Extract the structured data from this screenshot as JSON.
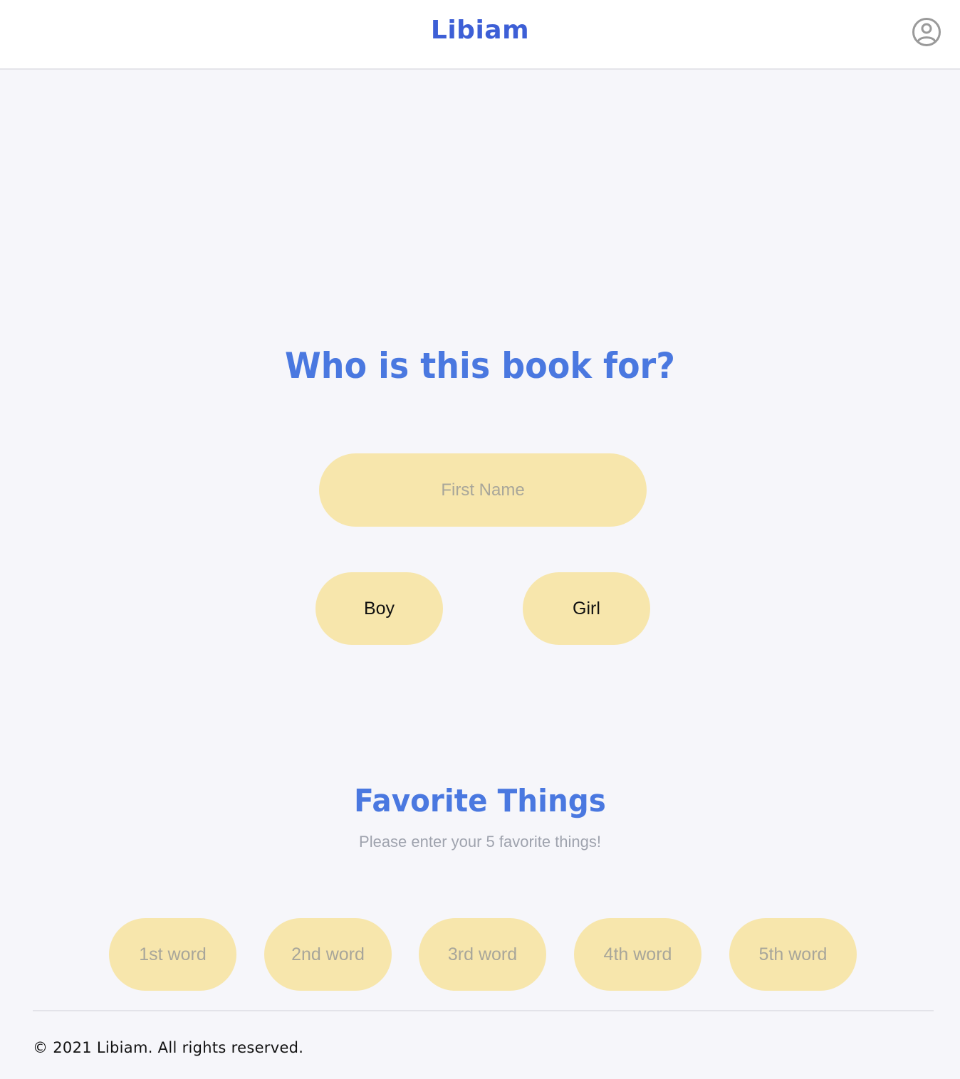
{
  "header": {
    "brand": "Libiam",
    "account_icon": "user-circle-icon"
  },
  "who": {
    "title": "Who is this book for?",
    "first_name_placeholder": "First Name",
    "first_name_value": "",
    "boy_label": "Boy",
    "girl_label": "Girl"
  },
  "favorites": {
    "title": "Favorite Things",
    "subtitle": "Please enter your 5 favorite things!",
    "words": [
      {
        "placeholder": "1st word",
        "value": ""
      },
      {
        "placeholder": "2nd word",
        "value": ""
      },
      {
        "placeholder": "3rd word",
        "value": ""
      },
      {
        "placeholder": "4th word",
        "value": ""
      },
      {
        "placeholder": "5th word",
        "value": ""
      }
    ]
  },
  "footer": {
    "copyright": "© 2021 Libiam. All rights reserved."
  },
  "colors": {
    "brand": "#3d5fd6",
    "title": "#4a78e0",
    "pill": "#f7e6ac",
    "background": "#f6f6fa"
  }
}
